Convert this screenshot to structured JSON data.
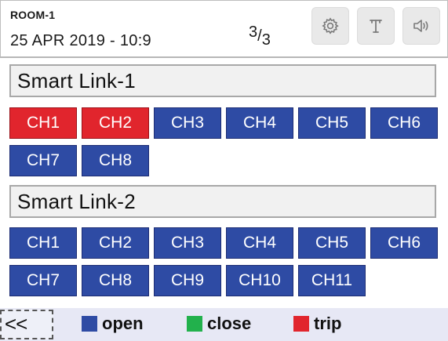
{
  "header": {
    "room": "ROOM-1",
    "datetime": "25 APR 2019 - 10:9",
    "page_current": "3",
    "page_sep": "/",
    "page_total": "3",
    "icons": [
      "gear-icon",
      "antenna-icon",
      "speaker-icon"
    ]
  },
  "links": [
    {
      "title": "Smart Link-1",
      "channels": [
        {
          "label": "CH1",
          "status": "trip"
        },
        {
          "label": "CH2",
          "status": "trip"
        },
        {
          "label": "CH3",
          "status": "open"
        },
        {
          "label": "CH4",
          "status": "open"
        },
        {
          "label": "CH5",
          "status": "open"
        },
        {
          "label": "CH6",
          "status": "open"
        },
        {
          "label": "CH7",
          "status": "open"
        },
        {
          "label": "CH8",
          "status": "open"
        }
      ]
    },
    {
      "title": "Smart Link-2",
      "channels": [
        {
          "label": "CH1",
          "status": "open"
        },
        {
          "label": "CH2",
          "status": "open"
        },
        {
          "label": "CH3",
          "status": "open"
        },
        {
          "label": "CH4",
          "status": "open"
        },
        {
          "label": "CH5",
          "status": "open"
        },
        {
          "label": "CH6",
          "status": "open"
        },
        {
          "label": "CH7",
          "status": "open"
        },
        {
          "label": "CH8",
          "status": "open"
        },
        {
          "label": "CH9",
          "status": "open"
        },
        {
          "label": "CH10",
          "status": "open"
        },
        {
          "label": "CH11",
          "status": "open"
        }
      ]
    }
  ],
  "footer": {
    "back_label": "<<",
    "legend": [
      {
        "label": "open",
        "color": "#2e4ba4"
      },
      {
        "label": "close",
        "color": "#22b14c"
      },
      {
        "label": "trip",
        "color": "#e1252d"
      }
    ]
  },
  "colors": {
    "open": "#2e4ba4",
    "close": "#22b14c",
    "trip": "#e1252d"
  }
}
